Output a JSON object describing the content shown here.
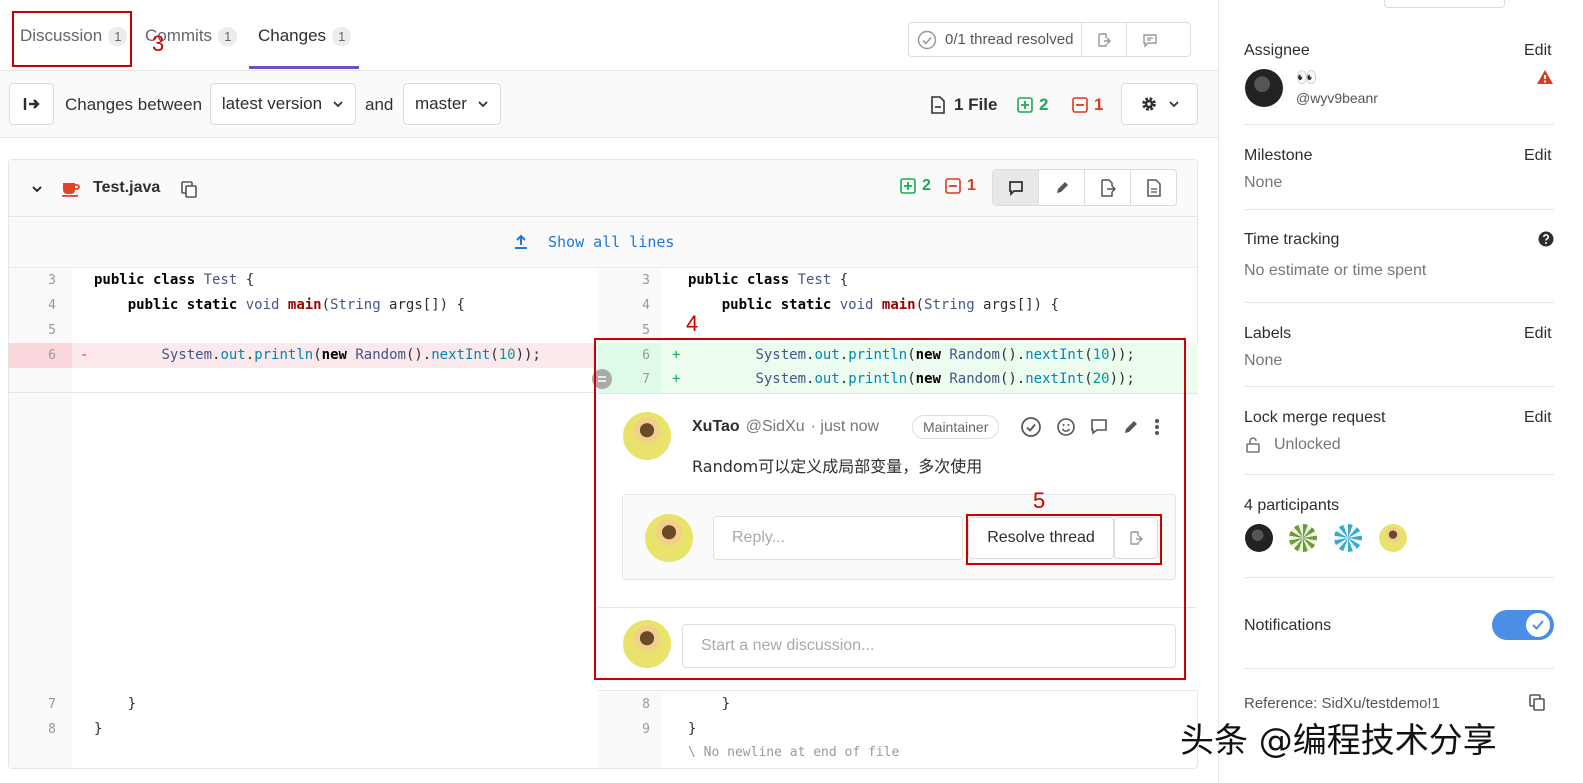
{
  "tabs": {
    "discussion": {
      "label": "Discussion",
      "count": "1"
    },
    "commits": {
      "label": "Commits",
      "count": "1"
    },
    "changes": {
      "label": "Changes",
      "count": "1"
    }
  },
  "annotations": {
    "n3": "3",
    "n4": "4",
    "n5": "5"
  },
  "threads": {
    "status": "0/1 thread resolved"
  },
  "toolbar": {
    "changes_between": "Changes between",
    "from_version": "latest version",
    "and": "and",
    "to_version": "master",
    "files": "1 File",
    "additions": "2",
    "deletions": "1"
  },
  "file": {
    "name": "Test.java",
    "additions": "2",
    "deletions": "1",
    "show_all": "Show all lines"
  },
  "diff": {
    "left_lines": [
      "3",
      "4",
      "5",
      "6",
      "7",
      "8"
    ],
    "right_lines": [
      "3",
      "4",
      "5",
      "6",
      "7",
      "8",
      "9"
    ],
    "no_newline": "\\ No newline at end of file"
  },
  "comment": {
    "author": "XuTao",
    "handle": "@SidXu",
    "time": "· just now",
    "role": "Maintainer",
    "body": "Random可以定义成局部变量，多次使用",
    "reply_placeholder": "Reply...",
    "resolve_label": "Resolve thread",
    "new_discussion_placeholder": "Start a new discussion..."
  },
  "sidebar": {
    "assignee": {
      "title": "Assignee",
      "edit": "Edit",
      "name": "👀",
      "handle": "@wyv9beanr"
    },
    "milestone": {
      "title": "Milestone",
      "edit": "Edit",
      "value": "None"
    },
    "time_tracking": {
      "title": "Time tracking",
      "value": "No estimate or time spent"
    },
    "labels": {
      "title": "Labels",
      "edit": "Edit",
      "value": "None"
    },
    "lock": {
      "title": "Lock merge request",
      "edit": "Edit",
      "value": "Unlocked"
    },
    "participants": {
      "title": "4 participants"
    },
    "notifications": {
      "title": "Notifications"
    },
    "reference": {
      "text": "Reference: SidXu/testdemo!1"
    }
  },
  "watermark": "头条 @编程技术分享",
  "colors": {
    "accent": "#6b4fbb",
    "add": "#1aaa55",
    "remove": "#db3b21",
    "toggle": "#4a8ee5",
    "annotation": "#cc0000"
  }
}
